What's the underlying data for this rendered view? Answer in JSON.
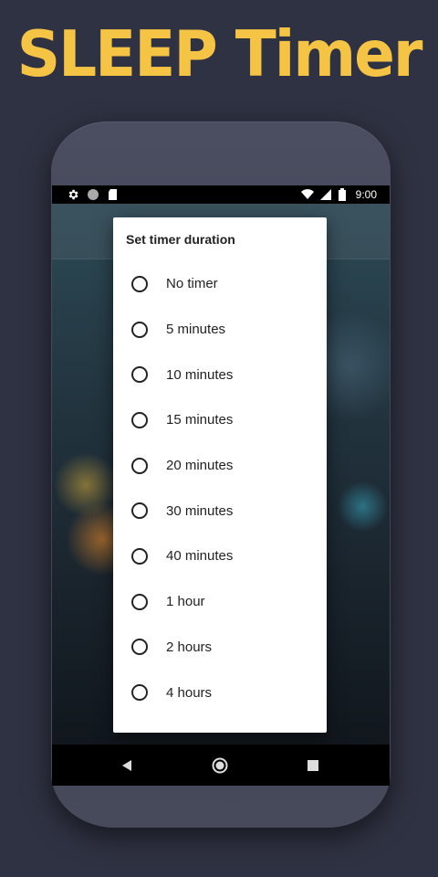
{
  "promo": {
    "title": "SLEEP Timer"
  },
  "status_bar": {
    "time": "9:00"
  },
  "dialog": {
    "title": "Set timer duration",
    "options": [
      {
        "label": "No timer"
      },
      {
        "label": "5 minutes"
      },
      {
        "label": "10 minutes"
      },
      {
        "label": "15 minutes"
      },
      {
        "label": "20 minutes"
      },
      {
        "label": "30 minutes"
      },
      {
        "label": "40 minutes"
      },
      {
        "label": "1 hour"
      },
      {
        "label": "2 hours"
      },
      {
        "label": "4 hours"
      }
    ]
  },
  "colors": {
    "accent": "#f5c445",
    "background": "#2f3242"
  },
  "icons": [
    "settings-icon",
    "circle-icon",
    "sd-card-icon",
    "wifi-icon",
    "signal-icon",
    "battery-icon",
    "back-icon",
    "home-icon",
    "recents-icon"
  ]
}
